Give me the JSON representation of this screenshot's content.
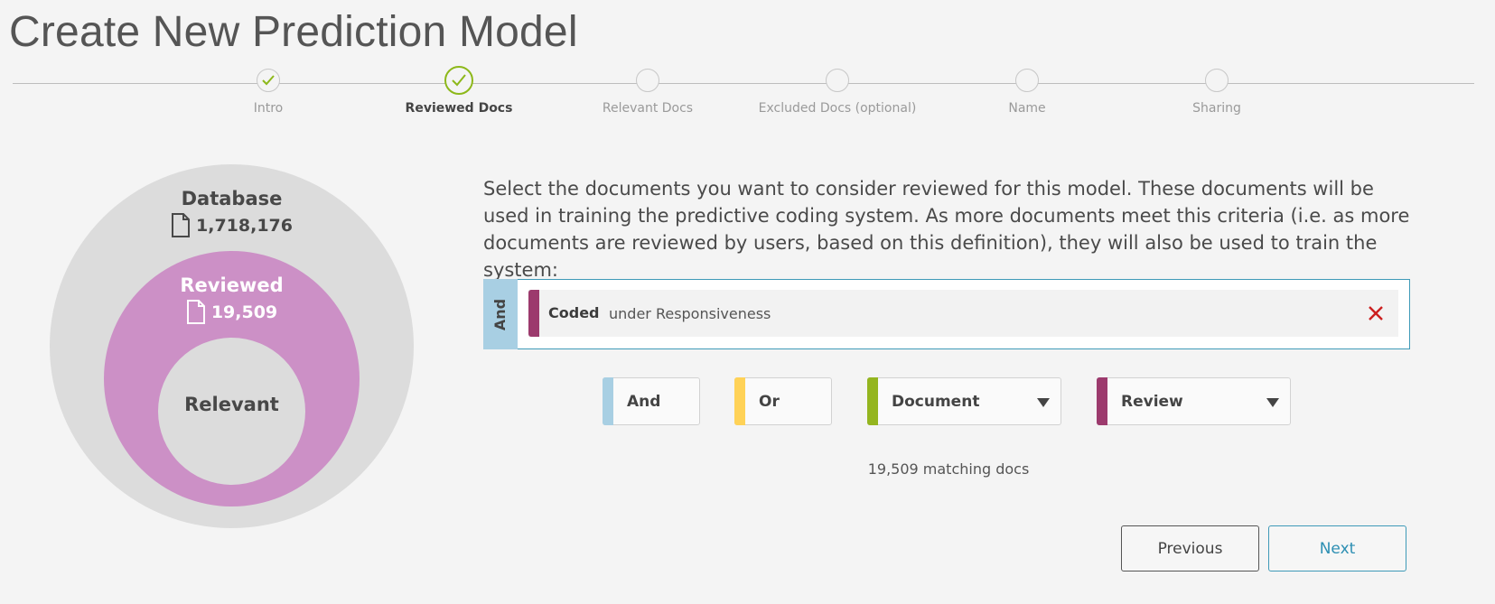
{
  "page": {
    "title": "Create New Prediction Model"
  },
  "stepper": {
    "steps": [
      {
        "label": "Intro",
        "state": "completed"
      },
      {
        "label": "Reviewed Docs",
        "state": "active"
      },
      {
        "label": "Relevant Docs",
        "state": "pending"
      },
      {
        "label": "Excluded Docs (optional)",
        "state": "pending"
      },
      {
        "label": "Name",
        "state": "pending"
      },
      {
        "label": "Sharing",
        "state": "pending"
      }
    ],
    "check_color": "#8db81a"
  },
  "venn": {
    "database": {
      "label": "Database",
      "count": "1,718,176",
      "color": "#dcdcdc"
    },
    "reviewed": {
      "label": "Reviewed",
      "count": "19,509",
      "color": "#cc90c6"
    },
    "relevant": {
      "label": "Relevant",
      "color": "#dcdcdc"
    }
  },
  "description": "Select the documents you want to consider reviewed for this model. These documents will be used in training the predictive coding system. As more documents meet this criteria (i.e. as more documents are reviewed by users, based on this definition), they will also be used to train the system:",
  "criteria": {
    "operator": "And",
    "operator_color": "#a8cfe3",
    "conditions": [
      {
        "field": "Coded",
        "description": "under Responsiveness",
        "color": "#9c3a6d",
        "remove_icon": "close-icon"
      }
    ]
  },
  "add_buttons": [
    {
      "label": "And",
      "color": "#a8cfe3",
      "dropdown": false
    },
    {
      "label": "Or",
      "color": "#ffd257",
      "dropdown": false
    },
    {
      "label": "Document",
      "color": "#94b51f",
      "dropdown": true
    },
    {
      "label": "Review",
      "color": "#9c3a6d",
      "dropdown": true
    }
  ],
  "matching_docs": "19,509 matching docs",
  "navigation": {
    "previous_label": "Previous",
    "next_label": "Next"
  }
}
